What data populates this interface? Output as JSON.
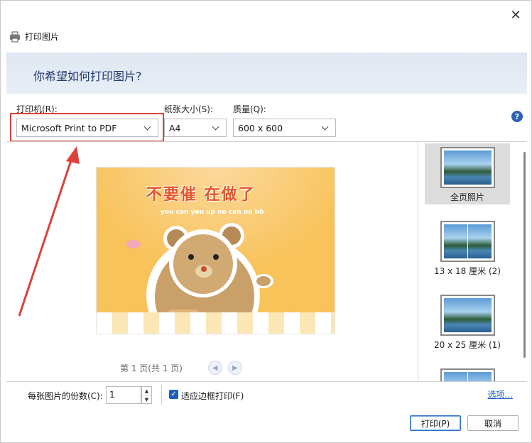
{
  "window": {
    "title": "打印图片",
    "close_glyph": "✕"
  },
  "header": {
    "question": "你希望如何打印图片?"
  },
  "printer": {
    "label": "打印机(R):",
    "value": "Microsoft Print to PDF"
  },
  "paper": {
    "label": "纸张大小(S):",
    "value": "A4"
  },
  "quality": {
    "label": "质量(Q):",
    "value": "600 x 600"
  },
  "help": {
    "glyph": "?"
  },
  "preview": {
    "photo_caption": "不要催 在做了",
    "photo_subcaption": "you can you up  no can no bb",
    "pager_text": "第 1 页(共 1 页)",
    "prev_glyph": "◀",
    "next_glyph": "▶"
  },
  "layouts": [
    {
      "label": "全页照片",
      "selected": true
    },
    {
      "label": "13 x 18 厘米 (2)",
      "selected": false
    },
    {
      "label": "20 x 25 厘米 (1)",
      "selected": false
    }
  ],
  "footer": {
    "copies_label": "每张图片的份数(C):",
    "copies_value": "1",
    "fit_label": "适应边框打印(F)",
    "fit_checked": true,
    "options_link": "选项...",
    "print_button": "打印(P)",
    "cancel_button": "取消"
  },
  "colors": {
    "highlight": "#e0403a",
    "accent": "#1f5fbf",
    "header_band": "#e3eaf4"
  }
}
